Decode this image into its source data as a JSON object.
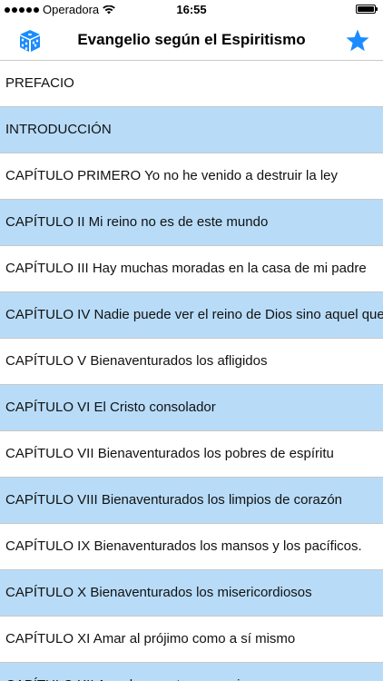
{
  "status_bar": {
    "carrier": "Operadora",
    "time": "16:55"
  },
  "nav": {
    "title": "Evangelio según el Espiritismo",
    "left_icon": "dice-icon",
    "right_icon": "star-icon",
    "accent_color": "#1a8cff"
  },
  "list": {
    "items": [
      "PREFACIO",
      "INTRODUCCIÓN",
      "CAPÍTULO PRIMERO Yo no he venido a destruir la ley",
      "CAPÍTULO II Mi reino no es de este mundo",
      "CAPÍTULO III Hay muchas moradas en la casa de mi padre",
      "CAPÍTULO IV Nadie puede ver el reino de Dios sino aquel que renaciere",
      "CAPÍTULO V Bienaventurados los afligidos",
      "CAPÍTULO VI El Cristo consolador",
      "CAPÍTULO VII Bienaventurados los pobres de espíritu",
      "CAPÍTULO VIII Bienaventurados los limpios de corazón",
      "CAPÍTULO IX Bienaventurados los mansos y los pacíficos.",
      "CAPÍTULO X Bienaventurados los misericordiosos",
      "CAPÍTULO XI Amar al prójimo como a sí mismo",
      "CAPÍTULO XII Amad a vuestros enemigos"
    ],
    "alt_row_color": "#b8dcf8"
  }
}
